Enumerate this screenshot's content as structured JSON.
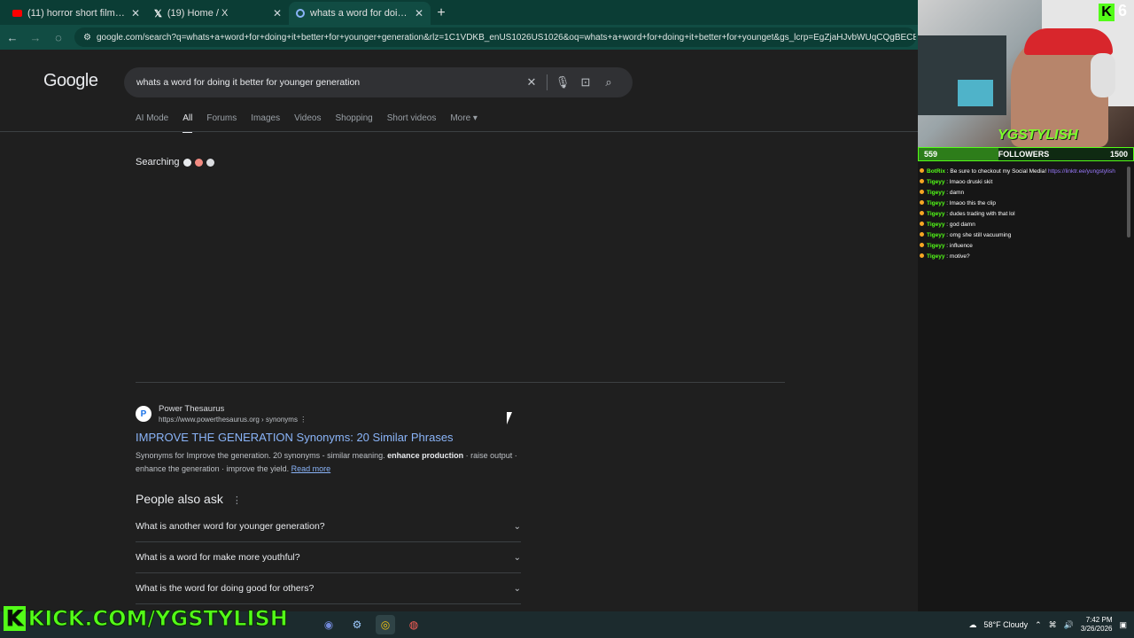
{
  "browser": {
    "tabs": [
      {
        "label": "(11) horror short film - YouTube",
        "icon": "youtube-icon"
      },
      {
        "label": "(19) Home / X",
        "icon": "x-icon"
      },
      {
        "label": "whats a word for doing it bette",
        "icon": "google-icon"
      }
    ],
    "url": "google.com/search?q=whats+a+word+for+doing+it+better+for+younger+generation&rlz=1C1VDKB_enUS1026US1026&oq=whats+a+word+for+doing+it+better+for+younget&gs_lcrp=EgZjaHJvbWUqCQgBECEYChgAT..."
  },
  "google": {
    "logo": "Google",
    "query": "whats a word for doing it better for younger generation",
    "tabs": [
      "AI Mode",
      "All",
      "Forums",
      "Images",
      "Videos",
      "Shopping",
      "Short videos",
      "More"
    ],
    "active_tab": "All",
    "searching_label": "Searching",
    "result": {
      "favicon": "P",
      "site": "Power Thesaurus",
      "url": "https://www.powerthesaurus.org › synonyms",
      "title": "IMPROVE THE GENERATION Synonyms: 20 Similar Phrases",
      "snippet_a": "Synonyms for Improve the generation. 20 synonyms - similar meaning.",
      "snippet_b": "enhance production",
      "snippet_c": "· raise output · enhance the generation · improve the yield.",
      "read_more": "Read more"
    },
    "paa_heading": "People also ask",
    "paa": [
      "What is another word for younger generation?",
      "What is a word for make more youthful?",
      "What is the word for doing good for others?"
    ]
  },
  "stream": {
    "channel_tag": "YGSTYLISH",
    "kick_count": "6",
    "followers_current": "559",
    "followers_label": "FOLLOWERS",
    "followers_goal": "1500",
    "followers_fraction": 0.373,
    "chat": [
      {
        "user": "BotRix",
        "msg": "Be sure to checkout my Social Media!",
        "link": "https://linktr.ee/yungstylish"
      },
      {
        "user": "Tigeyy",
        "msg": "lmaoo druski skit"
      },
      {
        "user": "Tigeyy",
        "msg": "damn"
      },
      {
        "user": "Tigeyy",
        "msg": "lmaoo this the clip"
      },
      {
        "user": "Tigeyy",
        "msg": "dudes trading with that lol"
      },
      {
        "user": "Tigeyy",
        "msg": "god damn"
      },
      {
        "user": "Tigeyy",
        "msg": "omg she still vacuuming"
      },
      {
        "user": "Tigeyy",
        "msg": "influence"
      },
      {
        "user": "Tigeyy",
        "msg": "motive?"
      }
    ],
    "banner": "KICK.COM/YGSTYLISH"
  },
  "taskbar": {
    "weather": "58°F  Cloudy",
    "time": "7:42 PM",
    "date": "3/26/2026"
  },
  "colors": {
    "kick_green": "#53fc18",
    "link_blue": "#8ab4f8",
    "tab_bar": "#0b3d35"
  }
}
